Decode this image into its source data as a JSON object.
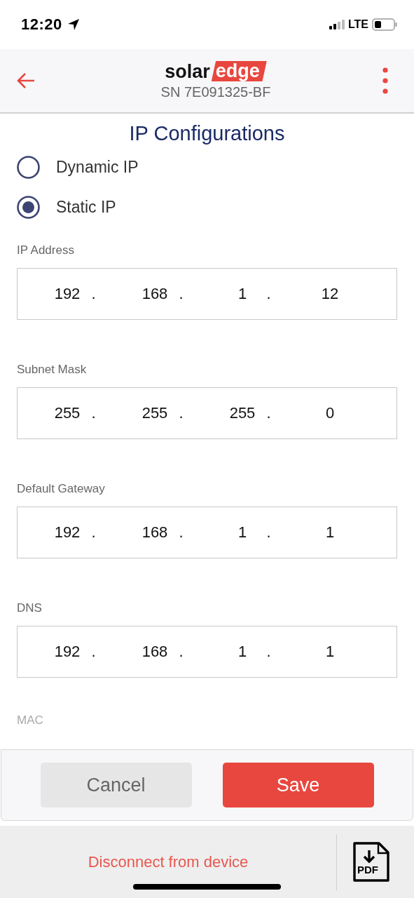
{
  "status_bar": {
    "time": "12:20",
    "network": "LTE"
  },
  "header": {
    "logo": {
      "dark": "solar",
      "red": "edge"
    },
    "subtitle": "SN 7E091325-BF"
  },
  "title": "IP Configurations",
  "ip_mode": [
    {
      "label": "Dynamic IP",
      "selected": false
    },
    {
      "label": "Static IP",
      "selected": true
    }
  ],
  "fields": [
    {
      "label": "IP Address",
      "octets": [
        "192",
        "168",
        "1",
        "12"
      ],
      "separator": "."
    },
    {
      "label": "Subnet Mask",
      "octets": [
        "255",
        "255",
        "255",
        "0"
      ],
      "separator": "."
    },
    {
      "label": "Default Gateway",
      "octets": [
        "192",
        "168",
        "1",
        "1"
      ],
      "separator": "."
    },
    {
      "label": "DNS",
      "octets": [
        "192",
        "168",
        "1",
        "1"
      ],
      "separator": "."
    }
  ],
  "mac_label": "MAC",
  "buttons": [
    {
      "kind": "secondary",
      "label": "Cancel"
    },
    {
      "kind": "primary",
      "label": "Save"
    }
  ],
  "bottom_bar": {
    "link": "Disconnect from device",
    "pdf_label": "PDF"
  }
}
